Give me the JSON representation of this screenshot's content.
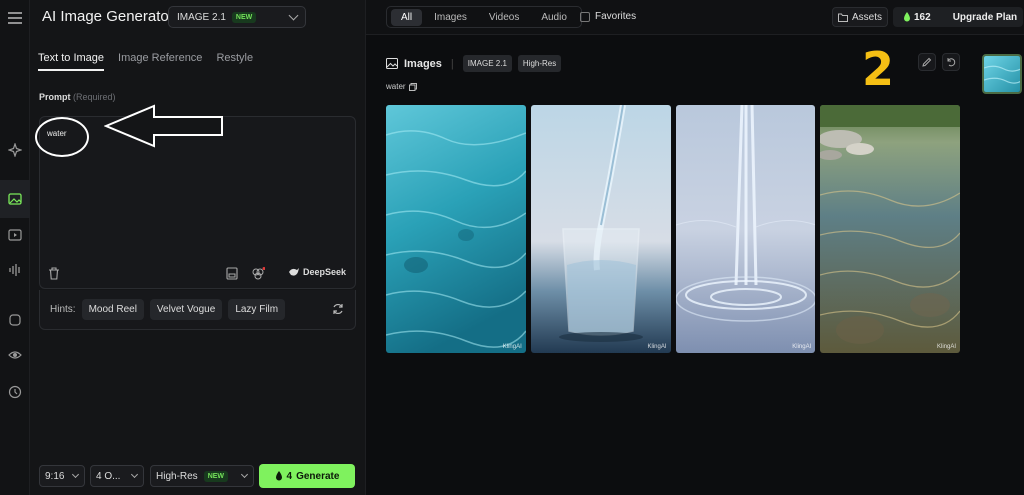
{
  "app": {
    "title": "AI Image Generator",
    "model": "IMAGE 2.1",
    "model_badge": "NEW"
  },
  "tabs": [
    "Text to Image",
    "Image Reference",
    "Restyle"
  ],
  "prompt": {
    "label": "Prompt",
    "required": "(Required)",
    "value": "water",
    "deepseek": "DeepSeek"
  },
  "hints": {
    "label": "Hints:",
    "chips": [
      "Mood Reel",
      "Velvet Vogue",
      "Lazy Film"
    ]
  },
  "bottom": {
    "ratio": "9:16",
    "count": "4 O...",
    "quality": "High-Res",
    "quality_badge": "NEW",
    "generate_cost": "4",
    "generate_label": "Generate"
  },
  "topbar": {
    "filters": [
      "All",
      "Images",
      "Videos",
      "Audio"
    ],
    "favorites": "Favorites",
    "assets": "Assets",
    "credits": "162",
    "upgrade": "Upgrade Plan"
  },
  "images_section": {
    "title": "Images",
    "tags": [
      "IMAGE 2.1",
      "High-Res"
    ],
    "prompt_ref": "water",
    "annotation": "2",
    "watermark": "KlingAI"
  },
  "icons": [
    "menu-icon",
    "image-icon",
    "video-icon",
    "audio-icon",
    "trash-icon",
    "save-icon",
    "refresh-icon",
    "flame-icon",
    "folder-icon",
    "edit-icon",
    "undo-icon",
    "copy-icon"
  ],
  "colors": {
    "accent": "#7ff25e",
    "background": "#0c0d0f",
    "annotation": "#f5bf14"
  }
}
